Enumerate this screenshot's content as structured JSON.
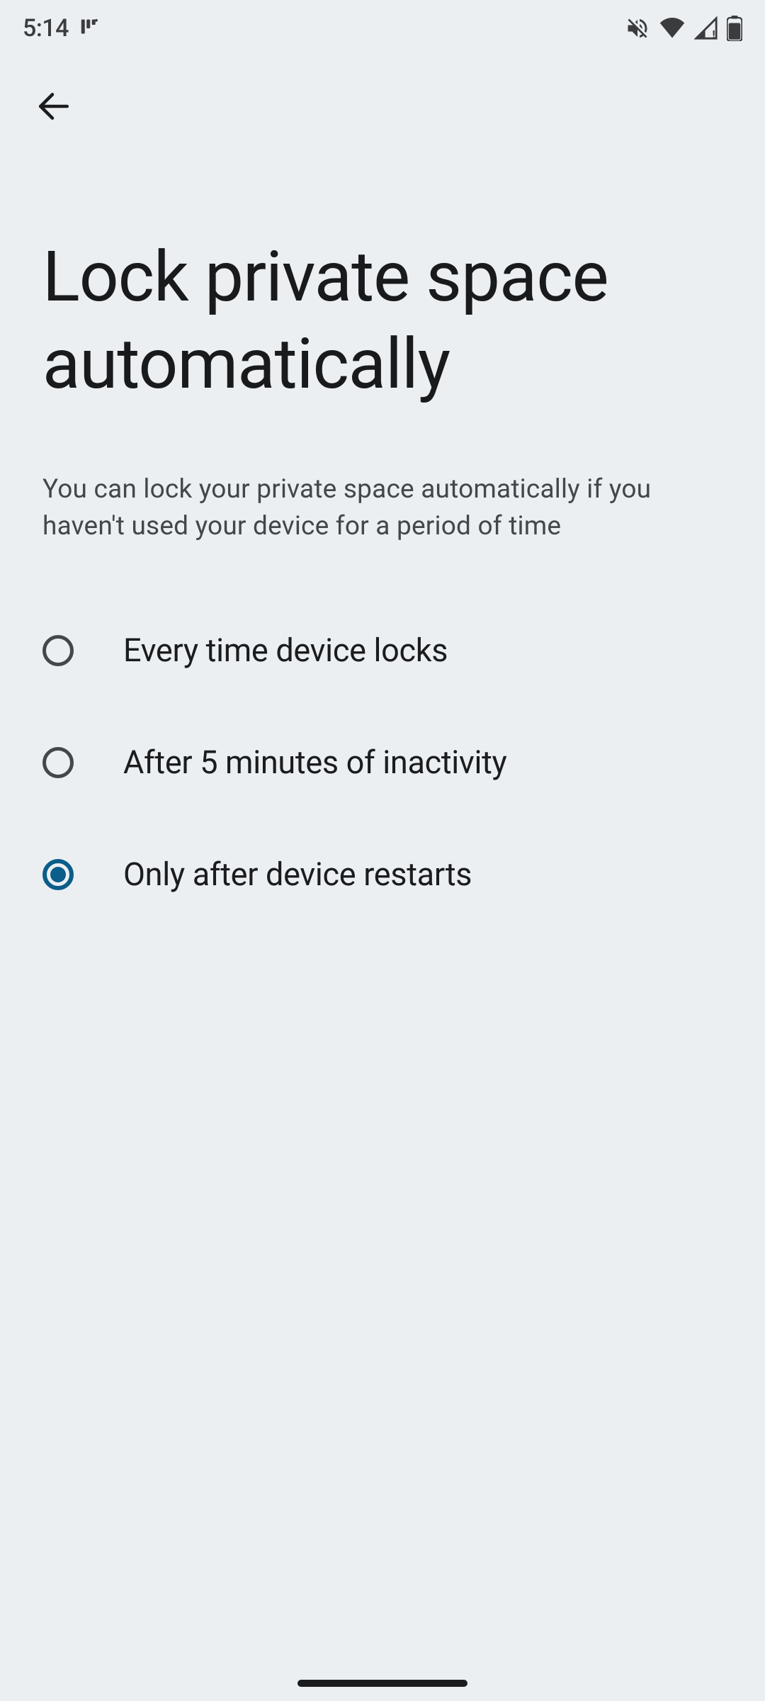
{
  "status": {
    "time": "5:14"
  },
  "header": {
    "title": "Lock private space automatically",
    "subtitle": "You can lock your private space automatically if you haven't used your device for a period of time"
  },
  "options": [
    {
      "label": "Every time device locks",
      "selected": false
    },
    {
      "label": "After 5 minutes of inactivity",
      "selected": false
    },
    {
      "label": "Only after device restarts",
      "selected": true
    }
  ]
}
